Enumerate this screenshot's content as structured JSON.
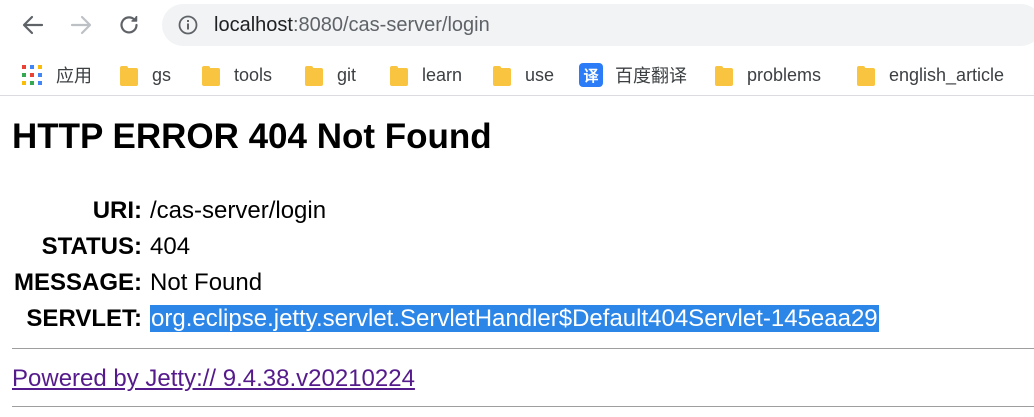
{
  "browser": {
    "url_host": "localhost",
    "url_rest": ":8080/cas-server/login"
  },
  "bookmarks": {
    "items": [
      {
        "label": "应用",
        "icon": "apps-grid-icon"
      },
      {
        "label": "gs",
        "icon": "folder-icon"
      },
      {
        "label": "tools",
        "icon": "folder-icon"
      },
      {
        "label": "git",
        "icon": "folder-icon"
      },
      {
        "label": "learn",
        "icon": "folder-icon"
      },
      {
        "label": "use",
        "icon": "folder-icon"
      },
      {
        "label": "百度翻译",
        "icon": "translate-icon",
        "icon_text": "译"
      },
      {
        "label": "problems",
        "icon": "folder-icon"
      },
      {
        "label": "english_article",
        "icon": "folder-icon"
      }
    ]
  },
  "page": {
    "title": "HTTP ERROR 404 Not Found",
    "rows": [
      {
        "key": "URI:",
        "value": "/cas-server/login"
      },
      {
        "key": "STATUS:",
        "value": "404"
      },
      {
        "key": "MESSAGE:",
        "value": "Not Found"
      },
      {
        "key": "SERVLET:",
        "value": "org.eclipse.jetty.servlet.ServletHandler$Default404Servlet-145eaa29"
      }
    ],
    "powered_by": "Powered by Jetty:// 9.4.38.v20210224"
  },
  "colors": {
    "selection": "#2b86e8",
    "visited_link": "#551a8b",
    "folder": "#f9c440",
    "translate_badge": "#2b7cf6",
    "omnibox_bg": "#f1f3f4"
  }
}
